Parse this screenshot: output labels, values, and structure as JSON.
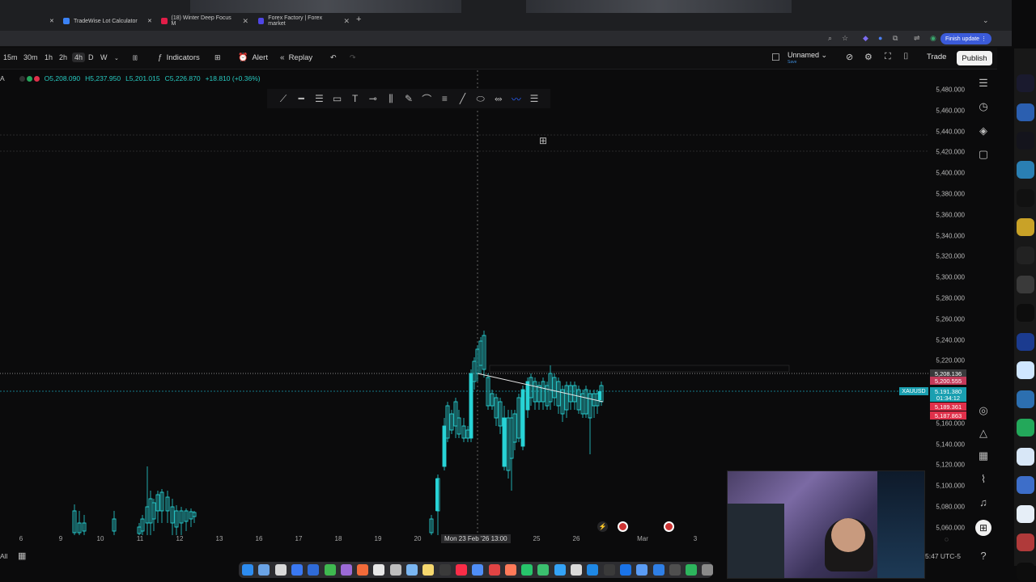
{
  "browser": {
    "tabs": [
      {
        "label": "TradeWise Lot Calculator",
        "color": "#3b82f6"
      },
      {
        "label": "(18) Winter Deep Focus M",
        "color": "#e11d48"
      },
      {
        "label": "Forex Factory | Forex market",
        "color": "#4f46e5"
      }
    ],
    "add_tab": "+",
    "finish_update": "Finish update"
  },
  "toolbar": {
    "timeframes": [
      "15m",
      "30m",
      "1h",
      "2h",
      "4h",
      "D",
      "W"
    ],
    "active_timeframe": "4h",
    "indicators": "Indicators",
    "alert": "Alert",
    "replay": "Replay",
    "layout_name": "Unnamed",
    "layout_sub": "Save",
    "trade": "Trade",
    "publish": "Publish"
  },
  "legend": {
    "symbol_letter": "A",
    "open": "O5,208.090",
    "high": "H5,237.950",
    "low": "L5,201.015",
    "close": "C5,226.870",
    "change": "+18.810 (+0.36%)"
  },
  "price_axis": [
    "5,480.000",
    "5,460.000",
    "5,440.000",
    "5,420.000",
    "5,400.000",
    "5,380.000",
    "5,360.000",
    "5,340.000",
    "5,320.000",
    "5,300.000",
    "5,280.000",
    "5,260.000",
    "5,240.000",
    "5,220.000",
    "5,160.000",
    "5,140.000",
    "5,120.000",
    "5,100.000",
    "5,080.000",
    "5,060.000"
  ],
  "price_tags": [
    {
      "text": "5,208.136",
      "color": "#3a3a3c"
    },
    {
      "text": "5,200.555",
      "color": "#c43a5a"
    },
    {
      "text": "5,191.380",
      "color": "#1a9fb0"
    },
    {
      "text": "01:34:12",
      "color": "#1a9fb0"
    },
    {
      "text": "5,189.361",
      "color": "#e0304a"
    },
    {
      "text": "5,187.863",
      "color": "#e0304a"
    }
  ],
  "symbol_tag": "XAUUSD",
  "time_axis": [
    "6",
    "9",
    "10",
    "11",
    "12",
    "13",
    "16",
    "17",
    "18",
    "19",
    "20",
    "25",
    "26",
    "Mar",
    "3"
  ],
  "time_cursor": "Mon 23 Feb '26   13:00",
  "clock": "5:47 UTC-5",
  "bottom_left": "All",
  "colors": {
    "bull": "#27d3d6",
    "bear": "#27d3d6",
    "accent": "#2962ff"
  }
}
